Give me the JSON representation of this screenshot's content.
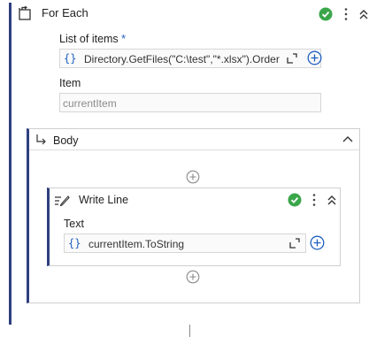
{
  "for_each": {
    "title": "For Each",
    "icon": "for-each-icon",
    "status_icon": "check-circle-icon",
    "status_color": "#3aa64a",
    "list_label": "List of items",
    "required_mark": "*",
    "list_braces": "{}",
    "list_value": "Directory.GetFiles(\"C:\\test\",\"*.xlsx\").Order",
    "item_label": "Item",
    "item_value": "currentItem"
  },
  "body": {
    "title": "Body",
    "icon": "subdirectory-arrow-icon"
  },
  "write_line": {
    "title": "Write Line",
    "icon": "write-line-icon",
    "status_icon": "check-circle-icon",
    "text_label": "Text",
    "text_braces": "{}",
    "text_value": "currentItem.ToString"
  },
  "colors": {
    "accent": "#2f3f7f",
    "link_blue": "#1f5fbf",
    "success": "#3aa64a"
  }
}
